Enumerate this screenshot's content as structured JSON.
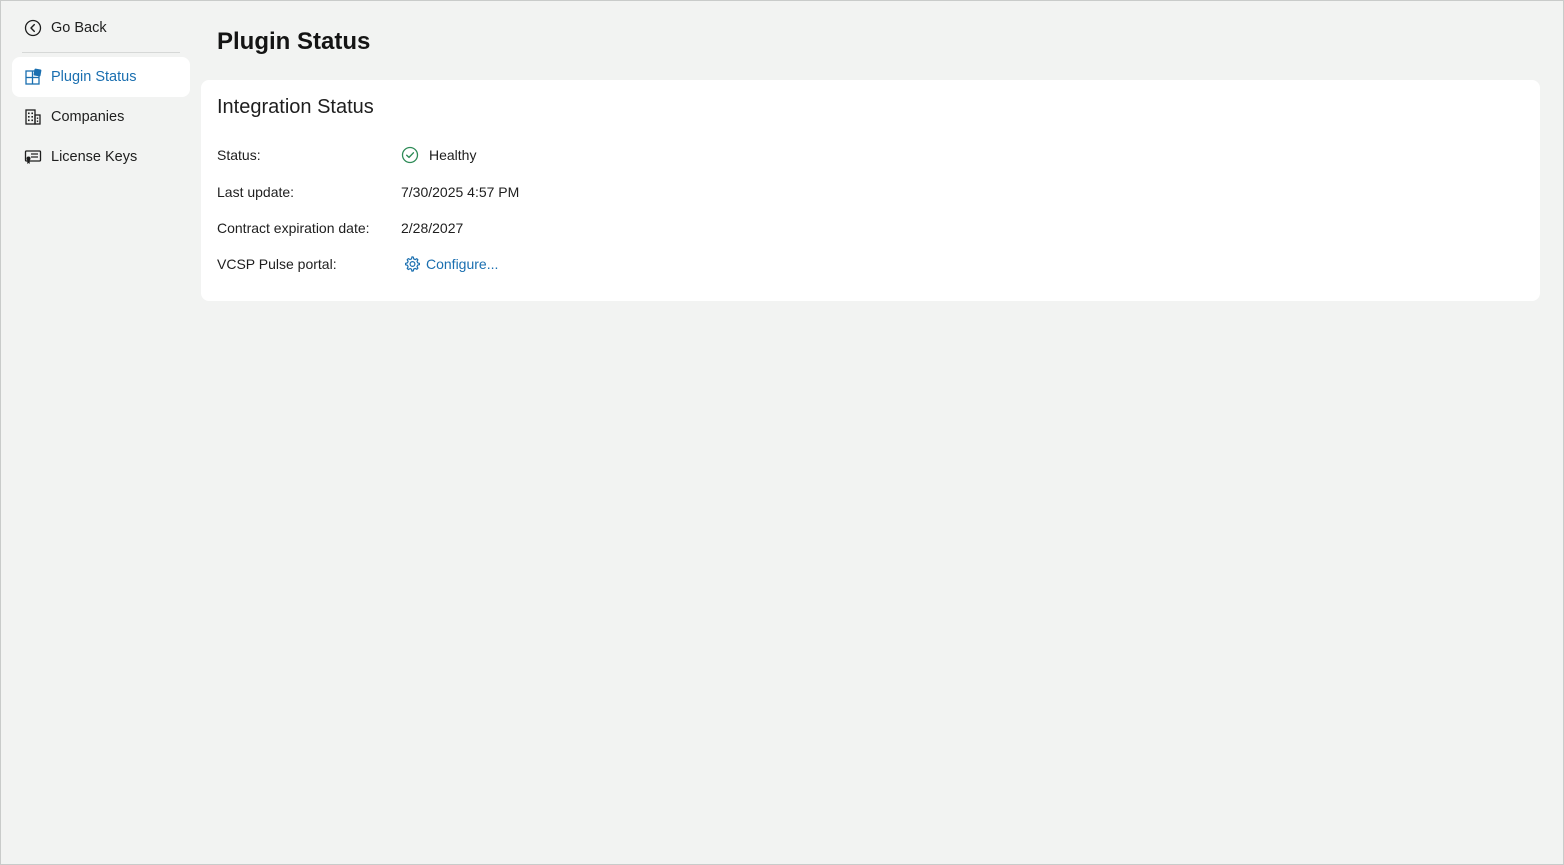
{
  "sidebar": {
    "go_back": {
      "label": "Go Back",
      "icon": "back-circle-icon"
    },
    "items": [
      {
        "label": "Plugin Status",
        "icon": "plugin-status-icon",
        "active": true
      },
      {
        "label": "Companies",
        "icon": "building-icon",
        "active": false
      },
      {
        "label": "License Keys",
        "icon": "license-key-icon",
        "active": false
      }
    ]
  },
  "page": {
    "title": "Plugin Status"
  },
  "integration": {
    "title": "Integration Status",
    "rows": [
      {
        "label": "Status:",
        "value": "Healthy",
        "icon": "check-circle-icon"
      },
      {
        "label": "Last update:",
        "value": "7/30/2025 4:57 PM"
      },
      {
        "label": "Contract expiration date:",
        "value": "2/28/2027"
      },
      {
        "label": "VCSP Pulse portal:",
        "value": "Configure...",
        "icon": "gear-icon",
        "is_link": true
      }
    ]
  },
  "colors": {
    "accent": "#1a6fb0",
    "healthy": "#2e8b57",
    "background": "#f2f3f2",
    "card": "#ffffff"
  }
}
